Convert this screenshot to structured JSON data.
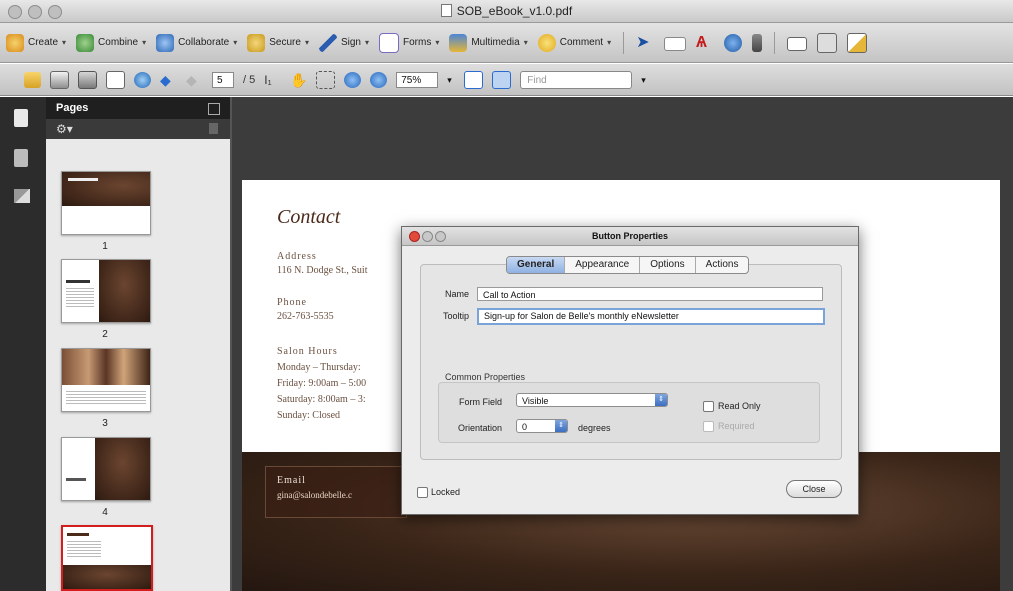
{
  "window": {
    "title": "SOB_eBook_v1.0.pdf"
  },
  "tasks_toolbar": {
    "items": [
      {
        "label": "Create",
        "icon": "create-icon"
      },
      {
        "label": "Combine",
        "icon": "combine-icon"
      },
      {
        "label": "Collaborate",
        "icon": "collaborate-icon"
      },
      {
        "label": "Secure",
        "icon": "lock-icon"
      },
      {
        "label": "Sign",
        "icon": "pen-icon"
      },
      {
        "label": "Forms",
        "icon": "forms-icon"
      },
      {
        "label": "Multimedia",
        "icon": "multimedia-icon"
      },
      {
        "label": "Comment",
        "icon": "comment-icon"
      }
    ]
  },
  "nav_toolbar": {
    "page_current": "5",
    "page_total": "/ 5",
    "zoom": "75%",
    "find_placeholder": "Find"
  },
  "pages_panel": {
    "title": "Pages",
    "pages": [
      "1",
      "2",
      "3",
      "4",
      "5"
    ],
    "selected_page": "5"
  },
  "document": {
    "heading": "Contact",
    "address_label": "Address",
    "address_value": "116 N. Dodge St., Suit",
    "phone_label": "Phone",
    "phone_value": "262-763-5535",
    "hours_label": "Salon Hours",
    "hours_lines": [
      "Monday – Thursday:",
      "Friday: 9:00am – 5:00",
      "Saturday: 8:00am – 3:",
      "Sunday: Closed"
    ],
    "email_label": "Email",
    "email_value": "gina@salondebelle.c"
  },
  "dialog": {
    "title": "Button Properties",
    "tabs": [
      "General",
      "Appearance",
      "Options",
      "Actions"
    ],
    "active_tab": "General",
    "name_label": "Name",
    "name_value": "Call to Action",
    "tooltip_label": "Tooltip",
    "tooltip_value": "Sign-up for Salon de Belle's monthly eNewsletter",
    "common_title": "Common Properties",
    "form_field_label": "Form Field",
    "form_field_value": "Visible",
    "orientation_label": "Orientation",
    "orientation_value": "0",
    "degrees_label": "degrees",
    "read_only_label": "Read Only",
    "required_label": "Required",
    "locked_label": "Locked",
    "close_label": "Close"
  }
}
